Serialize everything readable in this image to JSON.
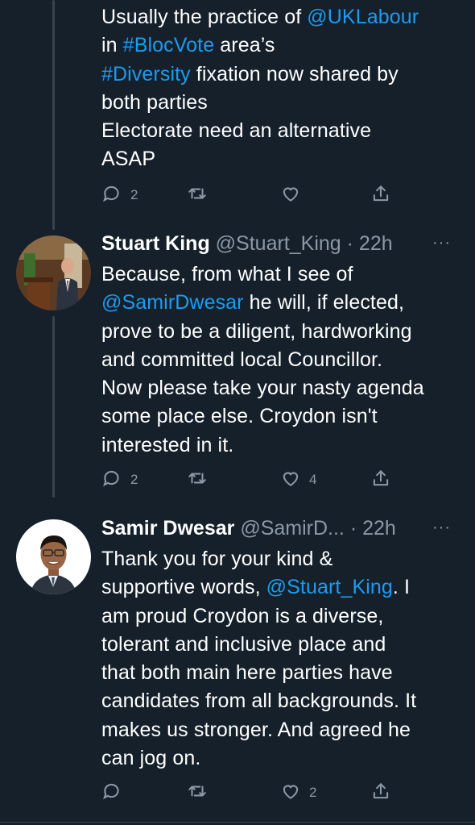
{
  "colors": {
    "background": "#15202b",
    "link": "#1d9bf0",
    "muted": "#8b98a5",
    "text": "#ffffff"
  },
  "tweets": [
    {
      "text": [
        {
          "t": "Usually the practice of "
        },
        {
          "t": "@UKLabour",
          "link": true
        },
        {
          "t": "\nin "
        },
        {
          "t": "#BlocVote",
          "link": true
        },
        {
          "t": " area’s\n"
        },
        {
          "t": "#Diversity",
          "link": true
        },
        {
          "t": " fixation now shared by\nboth parties\nElectorate need an alternative\nASAP"
        }
      ],
      "actions": {
        "reply": "2",
        "retweet": "",
        "like": "",
        "share": ""
      }
    },
    {
      "name": "Stuart King",
      "handle": "@Stuart_King",
      "time": "· 22h",
      "more": "···",
      "avatar_icon": "speaker-at-podium-photo",
      "text": [
        {
          "t": "Because, from what I see of\n"
        },
        {
          "t": "@SamirDwesar",
          "link": true
        },
        {
          "t": " he will, if elected,\nprove to be a diligent, hardworking\nand committed local Councillor.\nNow please take your nasty agenda\nsome place else. Croydon isn't\ninterested in it."
        }
      ],
      "actions": {
        "reply": "2",
        "retweet": "",
        "like": "4",
        "share": ""
      }
    },
    {
      "name": "Samir Dwesar",
      "handle": "@SamirD...",
      "time": "· 22h",
      "more": "···",
      "avatar_icon": "man-with-glasses-photo",
      "text": [
        {
          "t": "Thank you for your kind &\nsupportive words, "
        },
        {
          "t": "@Stuart_King",
          "link": true
        },
        {
          "t": ". I\nam proud Croydon is a diverse,\ntolerant and inclusive place and\nthat both main here parties have\ncandidates from all backgrounds. It\nmakes us stronger. And agreed he\ncan jog on."
        }
      ],
      "actions": {
        "reply": "",
        "retweet": "",
        "like": "2",
        "share": ""
      }
    }
  ]
}
